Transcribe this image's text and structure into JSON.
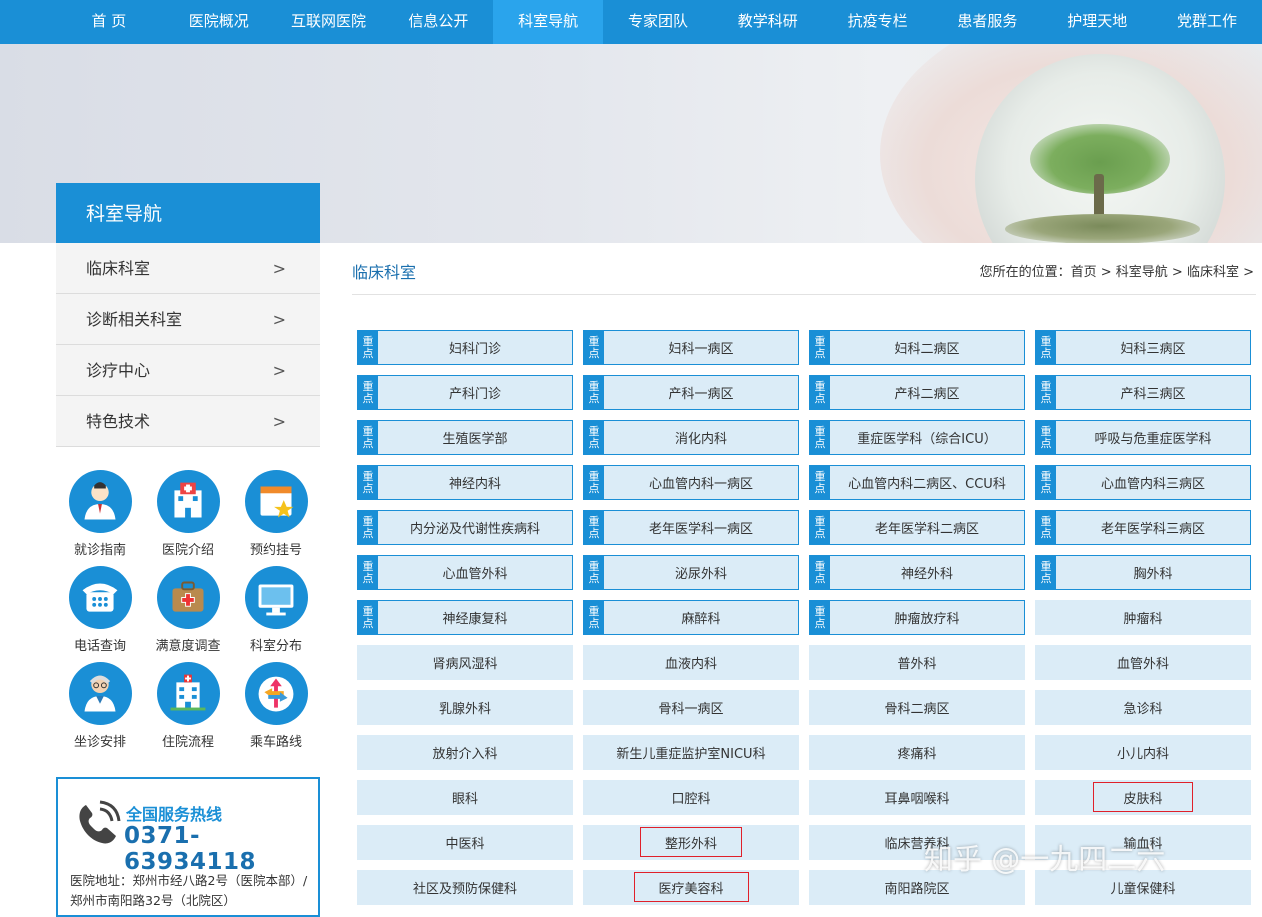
{
  "nav": {
    "items": [
      "首 页",
      "医院概况",
      "互联网医院",
      "信息公开",
      "科室导航",
      "专家团队",
      "教学科研",
      "抗疫专栏",
      "患者服务",
      "护理天地",
      "党群工作"
    ],
    "active_index": 4
  },
  "sidebar": {
    "title": "科室导航",
    "menu": [
      {
        "label": "临床科室",
        "arrow": ">"
      },
      {
        "label": "诊断相关科室",
        "arrow": ">"
      },
      {
        "label": "诊疗中心",
        "arrow": ">"
      },
      {
        "label": "特色技术",
        "arrow": ">"
      }
    ],
    "services": [
      {
        "label": "就诊指南",
        "icon": "doctor-icon"
      },
      {
        "label": "医院介绍",
        "icon": "hospital-icon"
      },
      {
        "label": "预约挂号",
        "icon": "calendar-star-icon"
      },
      {
        "label": "电话查询",
        "icon": "telephone-icon"
      },
      {
        "label": "满意度调查",
        "icon": "medical-kit-icon"
      },
      {
        "label": "科室分布",
        "icon": "computer-icon"
      },
      {
        "label": "坐诊安排",
        "icon": "senior-doctor-icon"
      },
      {
        "label": "住院流程",
        "icon": "hospital-building-icon"
      },
      {
        "label": "乘车路线",
        "icon": "route-arrows-icon"
      }
    ],
    "hotline": {
      "title": "全国服务热线",
      "number": "0371-63934118",
      "address": "医院地址：郑州市经八路2号（医院本部）/ 郑州市南阳路32号（北院区）"
    }
  },
  "main": {
    "title": "临床科室",
    "breadcrumb": {
      "prefix": "您所在的位置：",
      "items": [
        "首页",
        "科室导航",
        "临床科室"
      ],
      "separator": " > "
    },
    "key_tag": "重点",
    "departments": [
      {
        "name": "妇科门诊",
        "key": true
      },
      {
        "name": "妇科一病区",
        "key": true
      },
      {
        "name": "妇科二病区",
        "key": true
      },
      {
        "name": "妇科三病区",
        "key": true
      },
      {
        "name": "产科门诊",
        "key": true
      },
      {
        "name": "产科一病区",
        "key": true
      },
      {
        "name": "产科二病区",
        "key": true
      },
      {
        "name": "产科三病区",
        "key": true
      },
      {
        "name": "生殖医学部",
        "key": true
      },
      {
        "name": "消化内科",
        "key": true
      },
      {
        "name": "重症医学科（综合ICU）",
        "key": true
      },
      {
        "name": "呼吸与危重症医学科",
        "key": true
      },
      {
        "name": "神经内科",
        "key": true
      },
      {
        "name": "心血管内科一病区",
        "key": true
      },
      {
        "name": "心血管内科二病区、CCU科",
        "key": true
      },
      {
        "name": "心血管内科三病区",
        "key": true
      },
      {
        "name": "内分泌及代谢性疾病科",
        "key": true
      },
      {
        "name": "老年医学科一病区",
        "key": true
      },
      {
        "name": "老年医学科二病区",
        "key": true
      },
      {
        "name": "老年医学科三病区",
        "key": true
      },
      {
        "name": "心血管外科",
        "key": true
      },
      {
        "name": "泌尿外科",
        "key": true
      },
      {
        "name": "神经外科",
        "key": true
      },
      {
        "name": "胸外科",
        "key": true
      },
      {
        "name": "神经康复科",
        "key": true
      },
      {
        "name": "麻醉科",
        "key": true
      },
      {
        "name": "肿瘤放疗科",
        "key": true
      },
      {
        "name": "肿瘤科",
        "key": false
      },
      {
        "name": "肾病风湿科",
        "key": false
      },
      {
        "name": "血液内科",
        "key": false
      },
      {
        "name": "普外科",
        "key": false
      },
      {
        "name": "血管外科",
        "key": false
      },
      {
        "name": "乳腺外科",
        "key": false
      },
      {
        "name": "骨科一病区",
        "key": false
      },
      {
        "name": "骨科二病区",
        "key": false
      },
      {
        "name": "急诊科",
        "key": false
      },
      {
        "name": "放射介入科",
        "key": false
      },
      {
        "name": "新生儿重症监护室NICU科",
        "key": false
      },
      {
        "name": "疼痛科",
        "key": false
      },
      {
        "name": "小儿内科",
        "key": false
      },
      {
        "name": "眼科",
        "key": false
      },
      {
        "name": "口腔科",
        "key": false
      },
      {
        "name": "耳鼻咽喉科",
        "key": false
      },
      {
        "name": "皮肤科",
        "key": false,
        "highlighted": true
      },
      {
        "name": "中医科",
        "key": false
      },
      {
        "name": "整形外科",
        "key": false,
        "highlighted": true
      },
      {
        "name": "临床营养科",
        "key": false
      },
      {
        "name": "输血科",
        "key": false
      },
      {
        "name": "社区及预防保健科",
        "key": false
      },
      {
        "name": "医疗美容科",
        "key": false,
        "highlighted": true
      },
      {
        "name": "南阳路院区",
        "key": false
      },
      {
        "name": "儿童保健科",
        "key": false
      }
    ]
  },
  "watermark": "知乎 @一九四二六",
  "colors": {
    "primary": "#1a8fd6",
    "nav_active": "#2aa4ec",
    "cell_bg": "#dbecf7",
    "highlight_border": "#e0202a"
  }
}
